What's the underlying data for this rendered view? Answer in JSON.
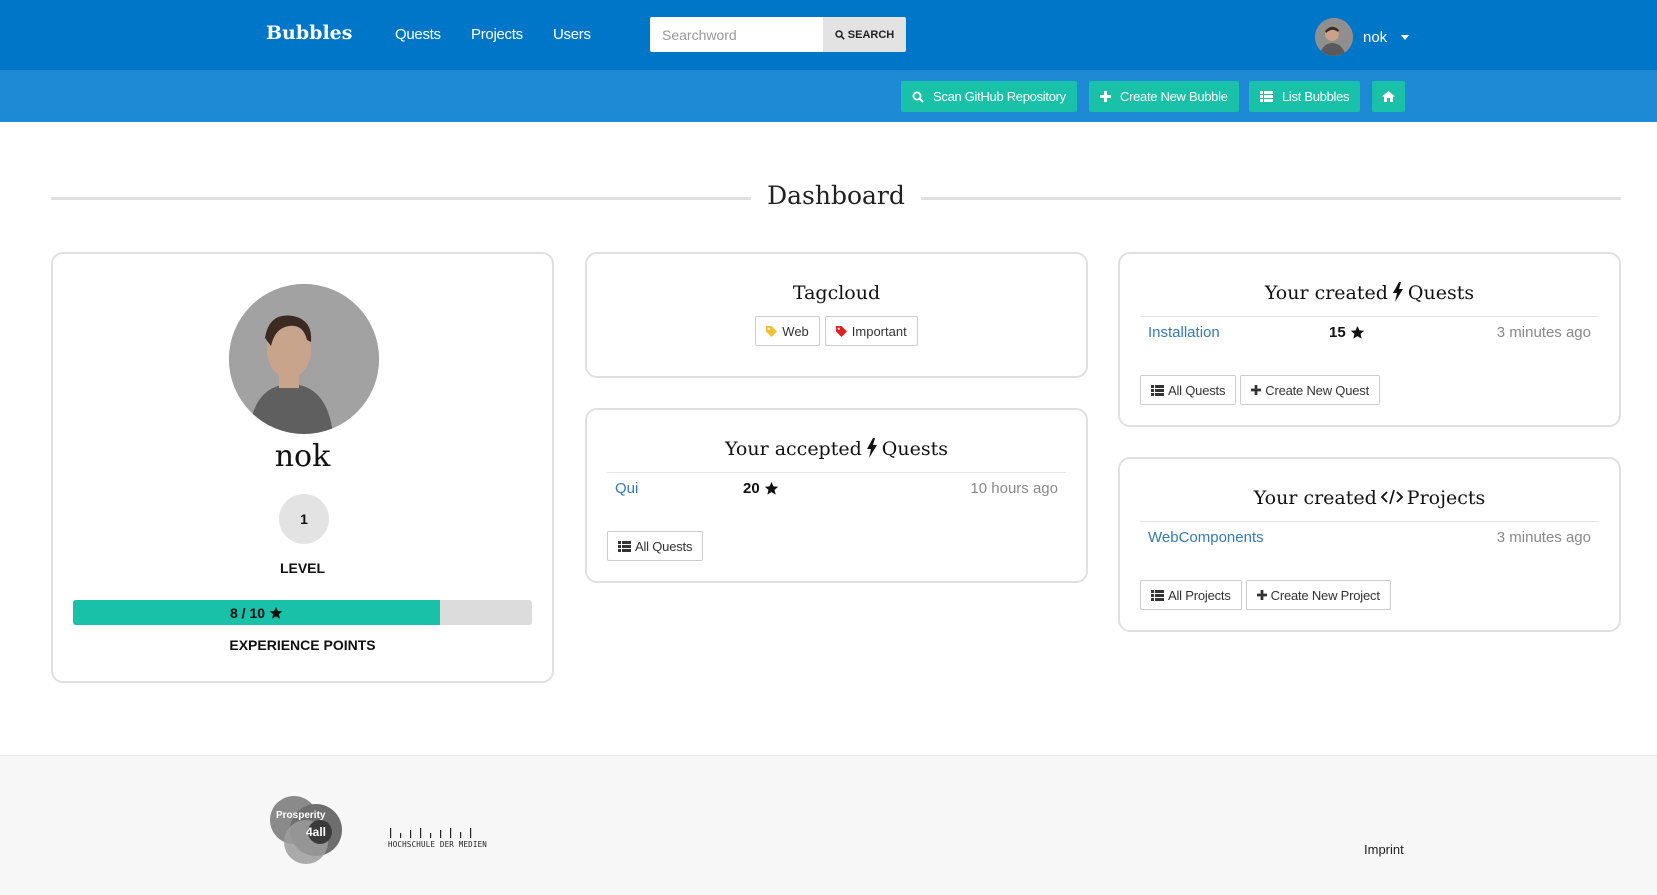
{
  "nav": {
    "brand": "Bubbles",
    "links": [
      "Quests",
      "Projects",
      "Users"
    ],
    "search_placeholder": "Searchword",
    "search_button": "SEARCH",
    "user_name": "nok"
  },
  "actions": {
    "scan": "Scan GitHub Repository",
    "create_bubble": "Create New Bubble",
    "list_bubbles": "List Bubbles"
  },
  "page_title": "Dashboard",
  "profile": {
    "name": "nok",
    "level": "1",
    "level_label": "LEVEL",
    "xp_text": "8 / 10",
    "xp_fraction": 0.8,
    "xp_label": "EXPERIENCE POINTS"
  },
  "tagcloud": {
    "title": "Tagcloud",
    "tags": [
      {
        "label": "Web",
        "color": "#f0c030"
      },
      {
        "label": "Important",
        "color": "#e02020"
      }
    ]
  },
  "accepted_quests": {
    "title_left": "Your accepted",
    "title_right": "Quests",
    "rows": [
      {
        "name": "Qui",
        "points": "20",
        "time": "10 hours ago"
      }
    ],
    "all_button": "All Quests"
  },
  "created_quests": {
    "title_left": "Your created",
    "title_right": "Quests",
    "rows": [
      {
        "name": "Installation",
        "points": "15",
        "time": "3 minutes ago"
      }
    ],
    "all_button": "All Quests",
    "create_button": "Create New Quest"
  },
  "created_projects": {
    "title_left": "Your created",
    "title_right": "Projects",
    "rows": [
      {
        "name": "WebComponents",
        "time": "3 minutes ago"
      }
    ],
    "all_button": "All Projects",
    "create_button": "Create New Project"
  },
  "footer": {
    "logo1_line1": "Prosperity",
    "logo1_line2": "4all",
    "logo2_text": "HOCHSCHULE DER MEDIEN",
    "imprint": "Imprint"
  },
  "colors": {
    "navbar": "#0076c8",
    "subbar": "#1e8ad6",
    "accent": "#18c1a7"
  }
}
